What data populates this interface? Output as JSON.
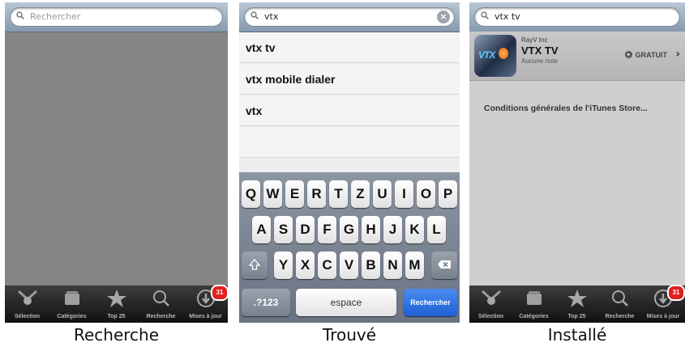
{
  "screens": {
    "recherche": {
      "search_placeholder": "Rechercher",
      "caption": "Recherche"
    },
    "trouve": {
      "search_value": "vtx",
      "suggestions": [
        "vtx tv",
        "vtx mobile dialer",
        "vtx"
      ],
      "keyboard": {
        "row1": [
          "Q",
          "W",
          "E",
          "R",
          "T",
          "Z",
          "U",
          "I",
          "O",
          "P"
        ],
        "row2": [
          "A",
          "S",
          "D",
          "F",
          "G",
          "H",
          "J",
          "K",
          "L"
        ],
        "row3": [
          "Y",
          "X",
          "C",
          "V",
          "B",
          "N",
          "M"
        ],
        "numbers": ".?123",
        "space": "espace",
        "search": "Rechercher"
      },
      "caption": "Trouvé"
    },
    "installe": {
      "search_value": "vtx tv",
      "result": {
        "publisher": "RayV Inc",
        "name": "VTX TV",
        "rating": "Aucune note",
        "price": "GRATUIT",
        "icon_text": "VTX"
      },
      "terms": "Conditions générales de l'iTunes Store...",
      "caption": "Installé"
    }
  },
  "tabbar": {
    "tabs": [
      {
        "label": "Sélection",
        "icon": "featured-icon"
      },
      {
        "label": "Catégories",
        "icon": "categories-icon"
      },
      {
        "label": "Top 25",
        "icon": "star-icon"
      },
      {
        "label": "Recherche",
        "icon": "search-icon"
      },
      {
        "label": "Mises à jour",
        "icon": "updates-icon"
      }
    ],
    "badge": "31"
  },
  "colors": {
    "badge": "#e01f1f",
    "search_key": "#1f5fd6"
  }
}
